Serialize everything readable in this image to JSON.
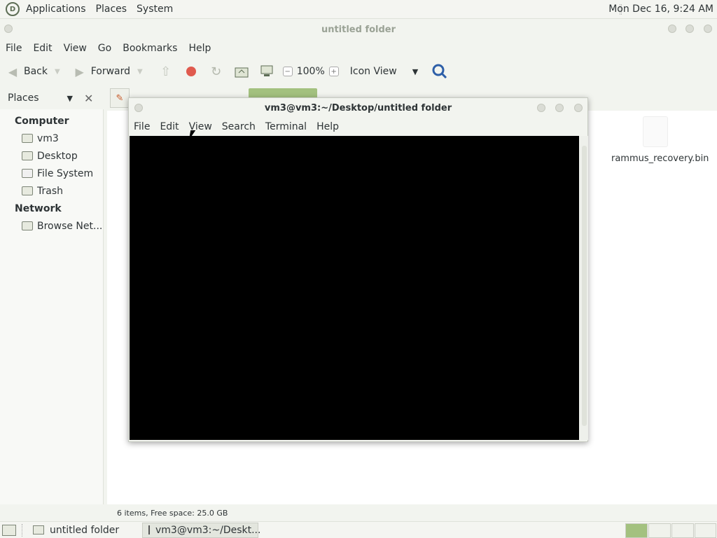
{
  "top_panel": {
    "menus": [
      "Applications",
      "Places",
      "System"
    ],
    "clock": "Mon Dec 16, 9:24 AM"
  },
  "file_manager": {
    "window_title": "untitled folder",
    "menubar": [
      "File",
      "Edit",
      "View",
      "Go",
      "Bookmarks",
      "Help"
    ],
    "toolbar": {
      "back_label": "Back",
      "forward_label": "Forward",
      "zoom_level": "100%",
      "view_mode": "Icon View"
    },
    "sidebar": {
      "selector_label": "Places",
      "sections": [
        {
          "title": "Computer",
          "items": [
            "vm3",
            "Desktop",
            "File System",
            "Trash"
          ]
        },
        {
          "title": "Network",
          "items": [
            "Browse Net..."
          ]
        }
      ]
    },
    "files": [
      {
        "name": "rammus_recovery.bin"
      }
    ],
    "status": "6 items, Free space: 25.0 GB"
  },
  "terminal": {
    "title": "vm3@vm3:~/Desktop/untitled folder",
    "menubar": [
      "File",
      "Edit",
      "View",
      "Search",
      "Terminal",
      "Help"
    ]
  },
  "taskbar": {
    "tasks": [
      {
        "label": "untitled folder",
        "active": false
      },
      {
        "label": "vm3@vm3:~/Deskt...",
        "active": true
      }
    ],
    "workspaces": 4,
    "active_workspace": 1
  },
  "colors": {
    "panel_bg": "#f4f5f1",
    "terminal_bg": "#000000",
    "workspace_active": "#a3c17f"
  }
}
